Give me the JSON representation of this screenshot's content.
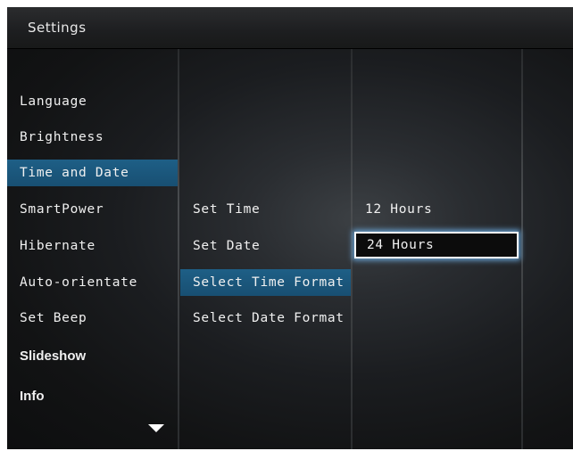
{
  "header": {
    "title": "Settings"
  },
  "menu": {
    "items": [
      {
        "label": "Language"
      },
      {
        "label": "Brightness"
      },
      {
        "label": "Time and Date",
        "selected": true
      },
      {
        "label": "SmartPower"
      },
      {
        "label": "Hibernate"
      },
      {
        "label": "Auto-orientate"
      },
      {
        "label": "Set Beep"
      },
      {
        "label": "Slideshow"
      },
      {
        "label": "Info"
      }
    ],
    "more_indicator": "chevron-down-icon"
  },
  "submenu": {
    "items": [
      {
        "label": "Set Time"
      },
      {
        "label": "Set Date"
      },
      {
        "label": "Select Time Format",
        "selected": true
      },
      {
        "label": "Select Date Format"
      }
    ]
  },
  "options": {
    "items": [
      {
        "label": "12 Hours"
      },
      {
        "label": "24 Hours",
        "focused": true
      }
    ]
  },
  "colors": {
    "highlight": "#1e5f86",
    "focus_border": "#ffffff",
    "text": "#f0f0f0"
  }
}
